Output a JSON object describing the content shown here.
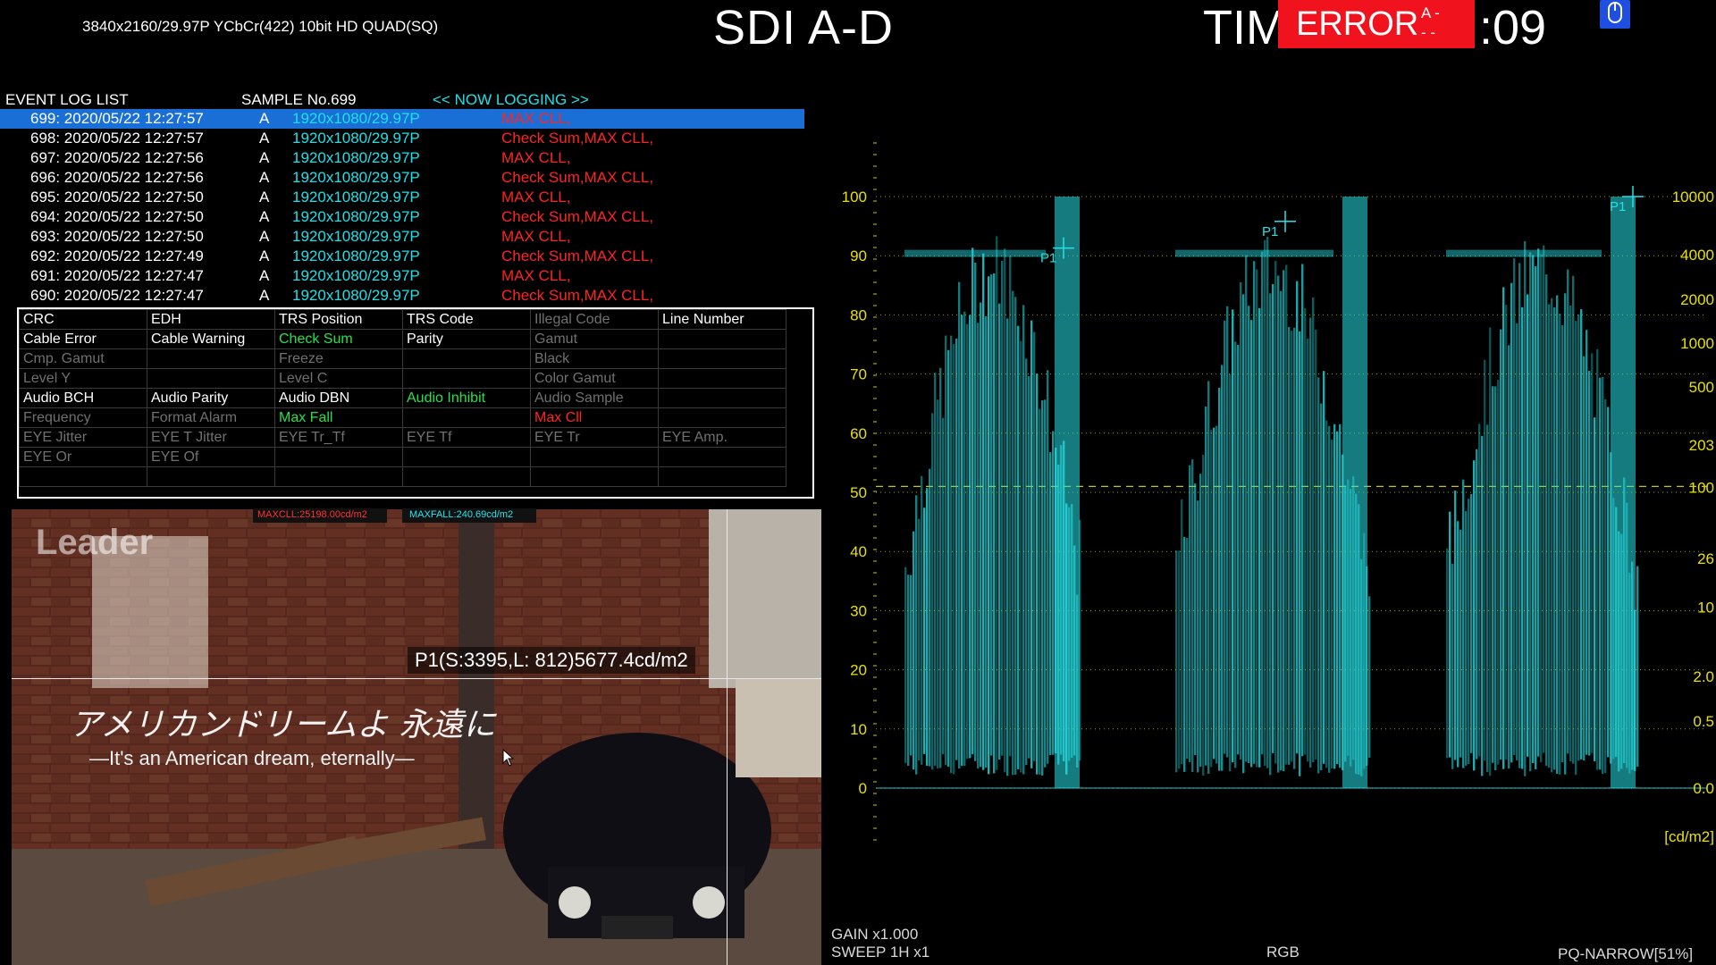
{
  "header": {
    "format": "3840x2160/29.97P YCbCr(422) 10bit HD QUAD(SQ)",
    "sdi_title": "SDI A-D",
    "time_prefix": "TIM",
    "time_suffix": ":09",
    "error_label": "ERROR",
    "error_channels": "A -\n- -"
  },
  "log": {
    "title": "EVENT LOG LIST",
    "sample": "SAMPLE No.699",
    "status": "<< NOW LOGGING >>",
    "rows": [
      {
        "no": "699: 2020/05/22 12:27:57",
        "ch": "A",
        "fmt": "1920x1080/29.97P",
        "err": "MAX CLL,",
        "selected": true
      },
      {
        "no": "698: 2020/05/22 12:27:57",
        "ch": "A",
        "fmt": "1920x1080/29.97P",
        "err": "Check Sum,MAX CLL,"
      },
      {
        "no": "697: 2020/05/22 12:27:56",
        "ch": "A",
        "fmt": "1920x1080/29.97P",
        "err": "MAX CLL,"
      },
      {
        "no": "696: 2020/05/22 12:27:56",
        "ch": "A",
        "fmt": "1920x1080/29.97P",
        "err": "Check Sum,MAX CLL,"
      },
      {
        "no": "695: 2020/05/22 12:27:50",
        "ch": "A",
        "fmt": "1920x1080/29.97P",
        "err": "MAX CLL,"
      },
      {
        "no": "694: 2020/05/22 12:27:50",
        "ch": "A",
        "fmt": "1920x1080/29.97P",
        "err": "Check Sum,MAX CLL,"
      },
      {
        "no": "693: 2020/05/22 12:27:50",
        "ch": "A",
        "fmt": "1920x1080/29.97P",
        "err": "MAX CLL,"
      },
      {
        "no": "692: 2020/05/22 12:27:49",
        "ch": "A",
        "fmt": "1920x1080/29.97P",
        "err": "Check Sum,MAX CLL,"
      },
      {
        "no": "691: 2020/05/22 12:27:47",
        "ch": "A",
        "fmt": "1920x1080/29.97P",
        "err": "MAX CLL,"
      },
      {
        "no": "690: 2020/05/22 12:27:47",
        "ch": "A",
        "fmt": "1920x1080/29.97P",
        "err": "Check Sum,MAX CLL,"
      }
    ]
  },
  "status_grid": [
    [
      {
        "t": "CRC",
        "s": "on"
      },
      {
        "t": "EDH",
        "s": "on"
      },
      {
        "t": "TRS Position",
        "s": "on"
      },
      {
        "t": "TRS Code",
        "s": "on"
      },
      {
        "t": "Illegal Code",
        "s": "off"
      },
      {
        "t": "Line Number",
        "s": "on"
      }
    ],
    [
      {
        "t": "Cable Error",
        "s": "on"
      },
      {
        "t": "Cable Warning",
        "s": "on"
      },
      {
        "t": "Check Sum",
        "s": "ok"
      },
      {
        "t": "Parity",
        "s": "on"
      },
      {
        "t": "Gamut",
        "s": "off"
      },
      {
        "t": "",
        "s": "off"
      }
    ],
    [
      {
        "t": "Cmp. Gamut",
        "s": "off"
      },
      {
        "t": "",
        "s": "off"
      },
      {
        "t": "Freeze",
        "s": "off"
      },
      {
        "t": "",
        "s": "off"
      },
      {
        "t": "Black",
        "s": "off"
      },
      {
        "t": "",
        "s": "off"
      }
    ],
    [
      {
        "t": "Level Y",
        "s": "off"
      },
      {
        "t": "",
        "s": "off"
      },
      {
        "t": "Level C",
        "s": "off"
      },
      {
        "t": "",
        "s": "off"
      },
      {
        "t": "Color Gamut",
        "s": "off"
      },
      {
        "t": "",
        "s": "off"
      }
    ],
    [
      {
        "t": "Audio BCH",
        "s": "on"
      },
      {
        "t": "Audio Parity",
        "s": "on"
      },
      {
        "t": "Audio DBN",
        "s": "on"
      },
      {
        "t": "Audio Inhibit",
        "s": "ok"
      },
      {
        "t": "Audio Sample",
        "s": "off"
      },
      {
        "t": "",
        "s": "off"
      }
    ],
    [
      {
        "t": "Frequency",
        "s": "off"
      },
      {
        "t": "Format Alarm",
        "s": "off"
      },
      {
        "t": "Max Fall",
        "s": "ok"
      },
      {
        "t": "",
        "s": "off"
      },
      {
        "t": "Max Cll",
        "s": "err"
      },
      {
        "t": "",
        "s": "off"
      }
    ],
    [
      {
        "t": "EYE Jitter",
        "s": "off"
      },
      {
        "t": "EYE T Jitter",
        "s": "off"
      },
      {
        "t": "EYE Tr_Tf",
        "s": "off"
      },
      {
        "t": "EYE Tf",
        "s": "off"
      },
      {
        "t": "EYE Tr",
        "s": "off"
      },
      {
        "t": "EYE Amp.",
        "s": "off"
      }
    ],
    [
      {
        "t": "EYE Or",
        "s": "off"
      },
      {
        "t": "EYE Of",
        "s": "off"
      },
      {
        "t": "",
        "s": "off"
      },
      {
        "t": "",
        "s": "off"
      },
      {
        "t": "",
        "s": "off"
      },
      {
        "t": "",
        "s": "off"
      }
    ],
    [
      {
        "t": "",
        "s": "off"
      },
      {
        "t": "",
        "s": "off"
      },
      {
        "t": "",
        "s": "off"
      },
      {
        "t": "",
        "s": "off"
      },
      {
        "t": "",
        "s": "off"
      },
      {
        "t": "",
        "s": "off"
      }
    ]
  ],
  "picture": {
    "maxcll": "MAXCLL:25198.00cd/m2",
    "maxfall": "MAXFALL:240.69cd/m2",
    "watermark": "Leader",
    "p1_info": "P1(S:3395,L: 812)5677.4cd/m2",
    "subtitle_jp": "アメリカンドリームよ 永遠に",
    "subtitle_en": "—It's an American dream, eternally—"
  },
  "waveform": {
    "left_scale": [
      "100",
      "90",
      "80",
      "70",
      "60",
      "50",
      "40",
      "30",
      "20",
      "10",
      "0"
    ],
    "right_scale": [
      "10000",
      "4000",
      "2000",
      "1000",
      "500",
      "203",
      "100",
      "26",
      "10",
      "2.0",
      "0.5",
      "0.0"
    ],
    "unit": "[cd/m2]",
    "cursor_label": "P1",
    "gain": "GAIN  x1.000",
    "sweep": "SWEEP  1H x1",
    "mode": "RGB",
    "curve": "PQ-NARROW[51%]",
    "colors": {
      "trace": "#27e0e6",
      "scale": "#e8e000",
      "grid": "#c8c800"
    }
  }
}
